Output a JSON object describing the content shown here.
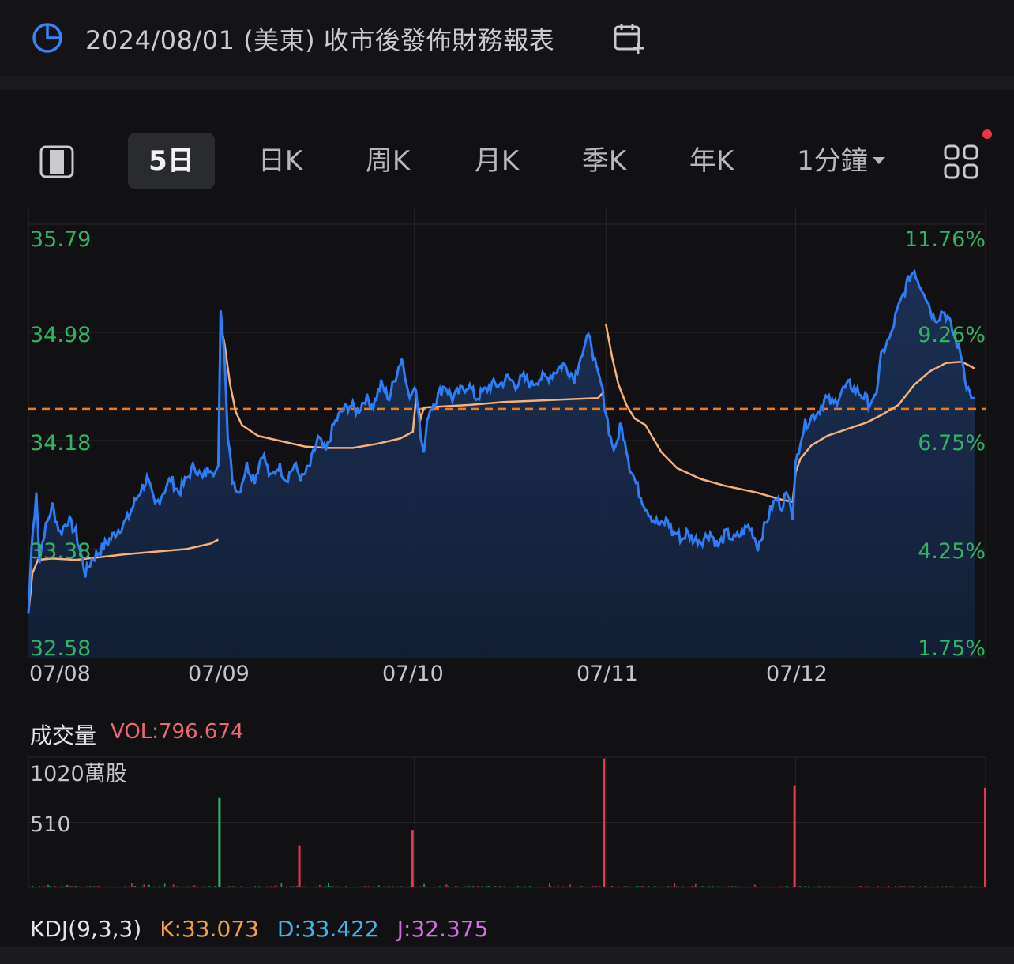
{
  "earnings": {
    "icon": "pie-chart-icon",
    "text": "2024/08/01 (美東) 收市後發佈財務報表",
    "calendar_icon": "calendar-add-icon"
  },
  "tabs": {
    "layout_icon": "layout-toggle-icon",
    "items": [
      {
        "label": "5日",
        "active": true
      },
      {
        "label": "日K",
        "active": false
      },
      {
        "label": "周K",
        "active": false
      },
      {
        "label": "月K",
        "active": false
      },
      {
        "label": "季K",
        "active": false
      },
      {
        "label": "年K",
        "active": false
      },
      {
        "label": "1分鐘",
        "active": false
      }
    ],
    "grid_icon": "grid-menu-icon"
  },
  "colors": {
    "price_line": "#2f7df6",
    "avg_line": "#f7b27a",
    "ref_line": "#f07a1a",
    "up": "#25b866",
    "down": "#e03a4f",
    "axis_text": "#2fb562"
  },
  "chart_data": {
    "type": "line",
    "y_labels": [
      "35.79",
      "34.98",
      "34.18",
      "33.38",
      "32.58"
    ],
    "pct_labels": [
      "11.76%",
      "9.26%",
      "6.75%",
      "4.25%",
      "1.75%"
    ],
    "x_labels": [
      "07/08",
      "07/09",
      "07/10",
      "07/11",
      "07/12"
    ],
    "ylim": [
      32.58,
      35.79
    ],
    "reference_price": 34.42,
    "series": [
      {
        "values": [
          [
            0,
            32.9
          ],
          [
            4,
            33.4
          ],
          [
            10,
            33.8
          ],
          [
            14,
            33.3
          ],
          [
            20,
            33.5
          ],
          [
            30,
            33.7
          ],
          [
            40,
            33.5
          ],
          [
            50,
            33.6
          ],
          [
            60,
            33.5
          ],
          [
            72,
            33.2
          ],
          [
            80,
            33.3
          ],
          [
            95,
            33.4
          ],
          [
            110,
            33.5
          ],
          [
            125,
            33.6
          ],
          [
            140,
            33.8
          ],
          [
            150,
            33.9
          ],
          [
            160,
            33.7
          ],
          [
            170,
            33.8
          ],
          [
            180,
            33.9
          ],
          [
            190,
            33.8
          ],
          [
            200,
            33.9
          ],
          [
            210,
            34.0
          ],
          [
            220,
            33.9
          ],
          [
            230,
            34.0
          ],
          [
            236,
            33.95
          ],
          [
            240,
            34.0
          ],
          [
            243,
            35.15
          ],
          [
            248,
            34.8
          ],
          [
            252,
            34.2
          ],
          [
            258,
            33.9
          ],
          [
            266,
            33.8
          ],
          [
            276,
            34.0
          ],
          [
            286,
            33.9
          ],
          [
            296,
            34.1
          ],
          [
            306,
            33.9
          ],
          [
            316,
            34.0
          ],
          [
            326,
            33.9
          ],
          [
            336,
            34.0
          ],
          [
            346,
            33.9
          ],
          [
            356,
            34.0
          ],
          [
            366,
            34.2
          ],
          [
            376,
            34.1
          ],
          [
            386,
            34.3
          ],
          [
            396,
            34.4
          ],
          [
            406,
            34.45
          ],
          [
            416,
            34.4
          ],
          [
            426,
            34.5
          ],
          [
            436,
            34.45
          ],
          [
            446,
            34.6
          ],
          [
            456,
            34.5
          ],
          [
            466,
            34.7
          ],
          [
            472,
            34.8
          ],
          [
            478,
            34.6
          ],
          [
            482,
            34.5
          ],
          [
            486,
            34.55
          ],
          [
            490,
            34.6
          ],
          [
            496,
            34.2
          ],
          [
            500,
            34.1
          ],
          [
            506,
            34.4
          ],
          [
            516,
            34.5
          ],
          [
            526,
            34.6
          ],
          [
            536,
            34.5
          ],
          [
            546,
            34.55
          ],
          [
            556,
            34.6
          ],
          [
            566,
            34.5
          ],
          [
            576,
            34.55
          ],
          [
            586,
            34.6
          ],
          [
            596,
            34.6
          ],
          [
            606,
            34.65
          ],
          [
            616,
            34.6
          ],
          [
            626,
            34.65
          ],
          [
            636,
            34.6
          ],
          [
            646,
            34.65
          ],
          [
            656,
            34.65
          ],
          [
            666,
            34.7
          ],
          [
            676,
            34.75
          ],
          [
            684,
            34.7
          ],
          [
            690,
            34.65
          ],
          [
            696,
            34.75
          ],
          [
            700,
            34.85
          ],
          [
            706,
            34.95
          ],
          [
            712,
            34.9
          ],
          [
            718,
            34.7
          ],
          [
            724,
            34.6
          ],
          [
            730,
            34.4
          ],
          [
            736,
            34.2
          ],
          [
            742,
            34.1
          ],
          [
            748,
            34.3
          ],
          [
            754,
            34.2
          ],
          [
            760,
            34.0
          ],
          [
            766,
            33.9
          ],
          [
            772,
            33.8
          ],
          [
            780,
            33.7
          ],
          [
            790,
            33.6
          ],
          [
            800,
            33.55
          ],
          [
            808,
            33.6
          ],
          [
            814,
            33.5
          ],
          [
            820,
            33.5
          ],
          [
            826,
            33.45
          ],
          [
            832,
            33.5
          ],
          [
            842,
            33.45
          ],
          [
            852,
            33.45
          ],
          [
            862,
            33.5
          ],
          [
            872,
            33.4
          ],
          [
            882,
            33.5
          ],
          [
            892,
            33.45
          ],
          [
            902,
            33.5
          ],
          [
            910,
            33.55
          ],
          [
            916,
            33.5
          ],
          [
            922,
            33.4
          ],
          [
            928,
            33.5
          ],
          [
            934,
            33.6
          ],
          [
            940,
            33.7
          ],
          [
            946,
            33.75
          ],
          [
            952,
            33.7
          ],
          [
            958,
            33.8
          ],
          [
            962,
            33.75
          ],
          [
            966,
            33.6
          ],
          [
            970,
            34.0
          ],
          [
            976,
            34.2
          ],
          [
            982,
            34.3
          ],
          [
            988,
            34.35
          ],
          [
            998,
            34.4
          ],
          [
            1008,
            34.5
          ],
          [
            1018,
            34.45
          ],
          [
            1028,
            34.55
          ],
          [
            1038,
            34.6
          ],
          [
            1048,
            34.55
          ],
          [
            1058,
            34.5
          ],
          [
            1064,
            34.45
          ],
          [
            1068,
            34.5
          ],
          [
            1072,
            34.55
          ],
          [
            1078,
            34.8
          ],
          [
            1084,
            34.9
          ],
          [
            1090,
            34.95
          ],
          [
            1096,
            35.1
          ],
          [
            1102,
            35.2
          ],
          [
            1108,
            35.3
          ],
          [
            1114,
            35.4
          ],
          [
            1120,
            35.45
          ],
          [
            1126,
            35.35
          ],
          [
            1132,
            35.3
          ],
          [
            1138,
            35.2
          ],
          [
            1144,
            35.1
          ],
          [
            1150,
            35.1
          ],
          [
            1156,
            35.15
          ],
          [
            1162,
            35.1
          ],
          [
            1168,
            35.0
          ],
          [
            1174,
            34.9
          ],
          [
            1180,
            34.8
          ],
          [
            1186,
            34.6
          ],
          [
            1192,
            34.5
          ],
          [
            1196,
            34.5
          ]
        ]
      },
      {
        "values": [
          [
            0,
            32.9
          ],
          [
            5,
            33.2
          ],
          [
            12,
            33.3
          ],
          [
            30,
            33.31
          ],
          [
            60,
            33.3
          ],
          [
            90,
            33.32
          ],
          [
            120,
            33.34
          ],
          [
            160,
            33.36
          ],
          [
            200,
            33.38
          ],
          [
            230,
            33.42
          ],
          [
            240,
            33.45
          ],
          [
            243,
            35.05
          ],
          [
            248,
            34.9
          ],
          [
            255,
            34.6
          ],
          [
            262,
            34.4
          ],
          [
            270,
            34.3
          ],
          [
            290,
            34.22
          ],
          [
            320,
            34.18
          ],
          [
            350,
            34.14
          ],
          [
            380,
            34.13
          ],
          [
            410,
            34.13
          ],
          [
            440,
            34.16
          ],
          [
            470,
            34.2
          ],
          [
            486,
            34.25
          ],
          [
            490,
            34.5
          ],
          [
            496,
            34.35
          ],
          [
            500,
            34.43
          ],
          [
            530,
            34.44
          ],
          [
            560,
            34.45
          ],
          [
            600,
            34.47
          ],
          [
            640,
            34.48
          ],
          [
            680,
            34.49
          ],
          [
            720,
            34.5
          ],
          [
            728,
            34.55
          ],
          [
            730,
            35.05
          ],
          [
            738,
            34.8
          ],
          [
            746,
            34.6
          ],
          [
            756,
            34.45
          ],
          [
            766,
            34.35
          ],
          [
            780,
            34.3
          ],
          [
            800,
            34.1
          ],
          [
            820,
            33.98
          ],
          [
            850,
            33.9
          ],
          [
            880,
            33.85
          ],
          [
            920,
            33.8
          ],
          [
            950,
            33.75
          ],
          [
            966,
            33.73
          ],
          [
            970,
            33.95
          ],
          [
            976,
            34.05
          ],
          [
            990,
            34.15
          ],
          [
            1010,
            34.22
          ],
          [
            1040,
            34.28
          ],
          [
            1060,
            34.32
          ],
          [
            1080,
            34.38
          ],
          [
            1100,
            34.45
          ],
          [
            1120,
            34.6
          ],
          [
            1140,
            34.7
          ],
          [
            1160,
            34.76
          ],
          [
            1180,
            34.77
          ],
          [
            1196,
            34.72
          ]
        ]
      }
    ],
    "volume": {
      "title": "成交量",
      "value_label": "VOL:796.674",
      "y_labels": [
        "1020萬股",
        "510"
      ],
      "ymax": 1020,
      "spikes": [
        {
          "x": 240,
          "v": 700,
          "color": "up"
        },
        {
          "x": 341,
          "v": 330,
          "color": "down"
        },
        {
          "x": 484,
          "v": 450,
          "color": "down"
        },
        {
          "x": 726,
          "v": 1010,
          "color": "down"
        },
        {
          "x": 967,
          "v": 800,
          "color": "down"
        },
        {
          "x": 1208,
          "v": 780,
          "color": "down"
        }
      ],
      "small_bar_level": 12
    },
    "kdj": {
      "title": "KDJ(9,3,3)",
      "k": "K:33.073",
      "d": "D:33.422",
      "j": "J:32.375"
    }
  }
}
